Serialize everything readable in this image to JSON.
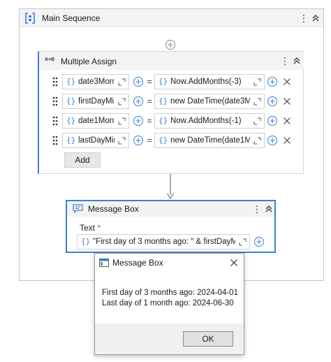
{
  "main_sequence": {
    "title": "Main Sequence",
    "menu_glyph": "⋮"
  },
  "multiple_assign": {
    "badge": "A+B",
    "title": "Multiple Assign",
    "menu_glyph": "⋮",
    "rows": [
      {
        "target": "date3Mont",
        "value": "Now.AddMonths(-3)"
      },
      {
        "target": "firstDayMir",
        "value": "new DateTime(date3Mc"
      },
      {
        "target": "date1Mont",
        "value": "Now.AddMonths(-1)"
      },
      {
        "target": "lastDayMir",
        "value": "new DateTime(date1Mc"
      }
    ],
    "brace": "{}",
    "equals": "=",
    "add_label": "Add"
  },
  "message_box_activity": {
    "title": "Message Box",
    "menu_glyph": "⋮",
    "text_label": "Text",
    "required_mark": "*",
    "brace": "{}",
    "text_value": "\"First day of 3 months ago: \" & firstDayMin"
  },
  "dialog": {
    "title": "Message Box",
    "line1": "First day of 3 months ago: 2024-04-01",
    "line2": "Last day of 1 month ago: 2024-06-30",
    "ok_label": "OK"
  },
  "colors": {
    "accent": "#3a7fd5",
    "header_bg": "#f3f3f3",
    "border": "#c8c8c8"
  }
}
